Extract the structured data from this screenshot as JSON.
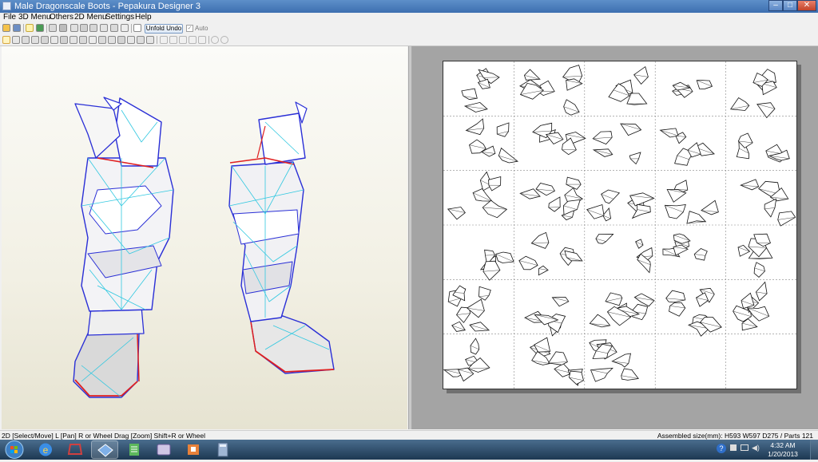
{
  "window": {
    "title": "Male Dragonscale Boots - Pepakura Designer 3"
  },
  "menu": [
    "File",
    "3D Menu",
    "Others",
    "2D Menu",
    "Settings",
    "Help"
  ],
  "toolbar": {
    "unfold_undo_label": "Unfold Undo",
    "auto_label": "Auto",
    "auto_checked": true
  },
  "status": {
    "left": "2D [Select/Move] L [Pan] R or Wheel Drag [Zoom] Shift+R or Wheel",
    "right": "Assembled size(mm): H593 W597 D275 / Parts 121"
  },
  "sheet": {
    "columns": 5,
    "rows": 6,
    "filled_cells": 28
  },
  "taskbar": {
    "apps": [
      "internet-explorer",
      "app-red-cube",
      "pepakura-designer",
      "app-green-document",
      "app-game",
      "app-orange-box",
      "app-calculator"
    ],
    "time": "4:32 AM",
    "date": "1/20/2013"
  }
}
